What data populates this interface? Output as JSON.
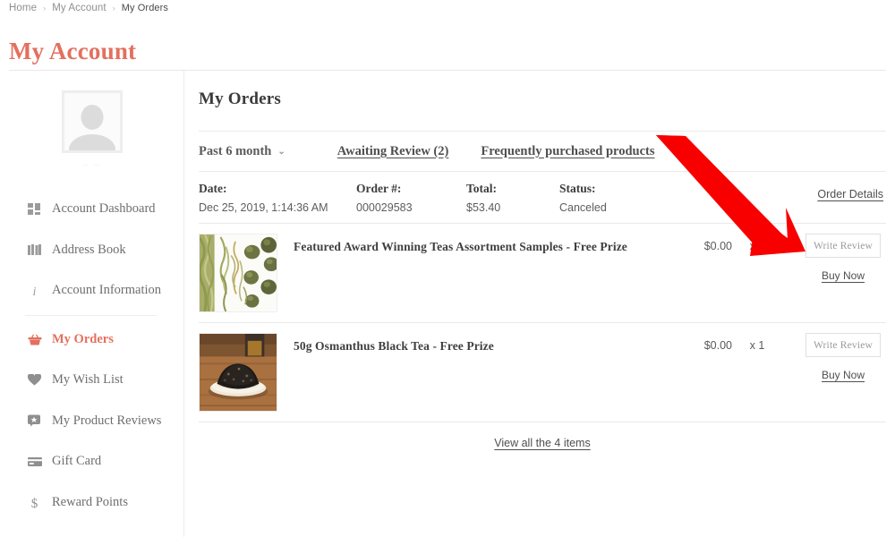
{
  "breadcrumb": {
    "items": [
      "Home",
      "My Account",
      "My Orders"
    ],
    "separator": "›"
  },
  "page_title": "My Account",
  "sidebar": {
    "avatar_caption": "— —",
    "items": [
      {
        "label": "Account Dashboard",
        "icon": "dashboard-grid-icon",
        "active": false
      },
      {
        "label": "Address Book",
        "icon": "address-book-icon",
        "active": false
      },
      {
        "label": "Account Information",
        "icon": "info-icon",
        "active": false
      },
      {
        "label": "My Orders",
        "icon": "basket-icon",
        "active": true
      },
      {
        "label": "My Wish List",
        "icon": "heart-icon",
        "active": false
      },
      {
        "label": "My Product Reviews",
        "icon": "review-bubble-icon",
        "active": false
      },
      {
        "label": "Gift Card",
        "icon": "credit-card-icon",
        "active": false
      },
      {
        "label": "Reward Points",
        "icon": "dollar-icon",
        "active": false
      }
    ]
  },
  "main": {
    "title": "My Orders",
    "filters": {
      "period": "Past 6 month",
      "caret": "⌄",
      "awaiting_review": "Awaiting Review (2)",
      "frequently_purchased": "Frequently purchased products"
    },
    "order": {
      "columns": {
        "date": "Date:",
        "order_no": "Order #:",
        "total": "Total:",
        "status": "Status:"
      },
      "values": {
        "date": "Dec 25, 2019, 1:14:36 AM",
        "order_no": "000029583",
        "total": "$53.40",
        "status": "Canceled"
      },
      "details_link": "Order Details"
    },
    "products": [
      {
        "name": "Featured Award Winning Teas Assortment Samples - Free Prize",
        "price": "$0.00",
        "qty": "x 1",
        "review_button": "Write Review",
        "buy_link": "Buy Now",
        "thumb": "green-tea-leaves-photo"
      },
      {
        "name": "50g Osmanthus Black Tea - Free Prize",
        "price": "$0.00",
        "qty": "x 1",
        "review_button": "Write Review",
        "buy_link": "Buy Now",
        "thumb": "black-tea-bowl-photo"
      }
    ],
    "view_all": "View all the 4 items"
  },
  "annotation": {
    "arrow_color": "#F80000",
    "points_to": "Write Review"
  },
  "colors": {
    "accent": "#e3705e",
    "text": "#4a4a4a",
    "muted": "#8f8f8f",
    "rule": "#eaeaea"
  }
}
